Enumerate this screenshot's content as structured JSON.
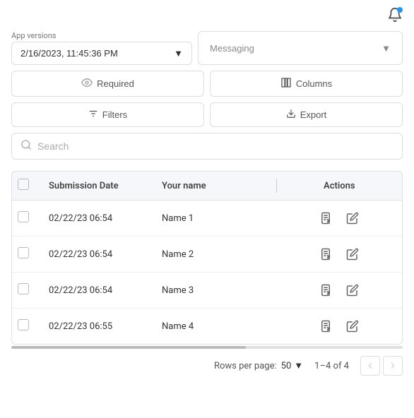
{
  "topbar": {
    "notification_icon": "bell-icon"
  },
  "version_section": {
    "label": "App versions",
    "selected_version": "2/16/2023, 11:45:36 PM",
    "chevron": "▾"
  },
  "messaging_btn": {
    "label": "Messaging",
    "chevron": "▾"
  },
  "required_btn": {
    "label": "Required",
    "icon": "eye-icon"
  },
  "columns_btn": {
    "label": "Columns",
    "icon": "columns-icon"
  },
  "filters_btn": {
    "label": "Filters",
    "icon": "filter-icon"
  },
  "export_btn": {
    "label": "Export",
    "icon": "export-icon"
  },
  "search": {
    "placeholder": "Search"
  },
  "table": {
    "columns": [
      "Submission Date",
      "Your name",
      "Actions"
    ],
    "rows": [
      {
        "date": "02/22/23 06:54",
        "name": "Name 1"
      },
      {
        "date": "02/22/23 06:54",
        "name": "Name 2"
      },
      {
        "date": "02/22/23 06:54",
        "name": "Name 3"
      },
      {
        "date": "02/22/23 06:55",
        "name": "Name 4"
      }
    ]
  },
  "footer": {
    "rows_per_page_label": "Rows per page:",
    "rows_per_page_value": "50",
    "pagination_info": "1–4 of 4"
  }
}
